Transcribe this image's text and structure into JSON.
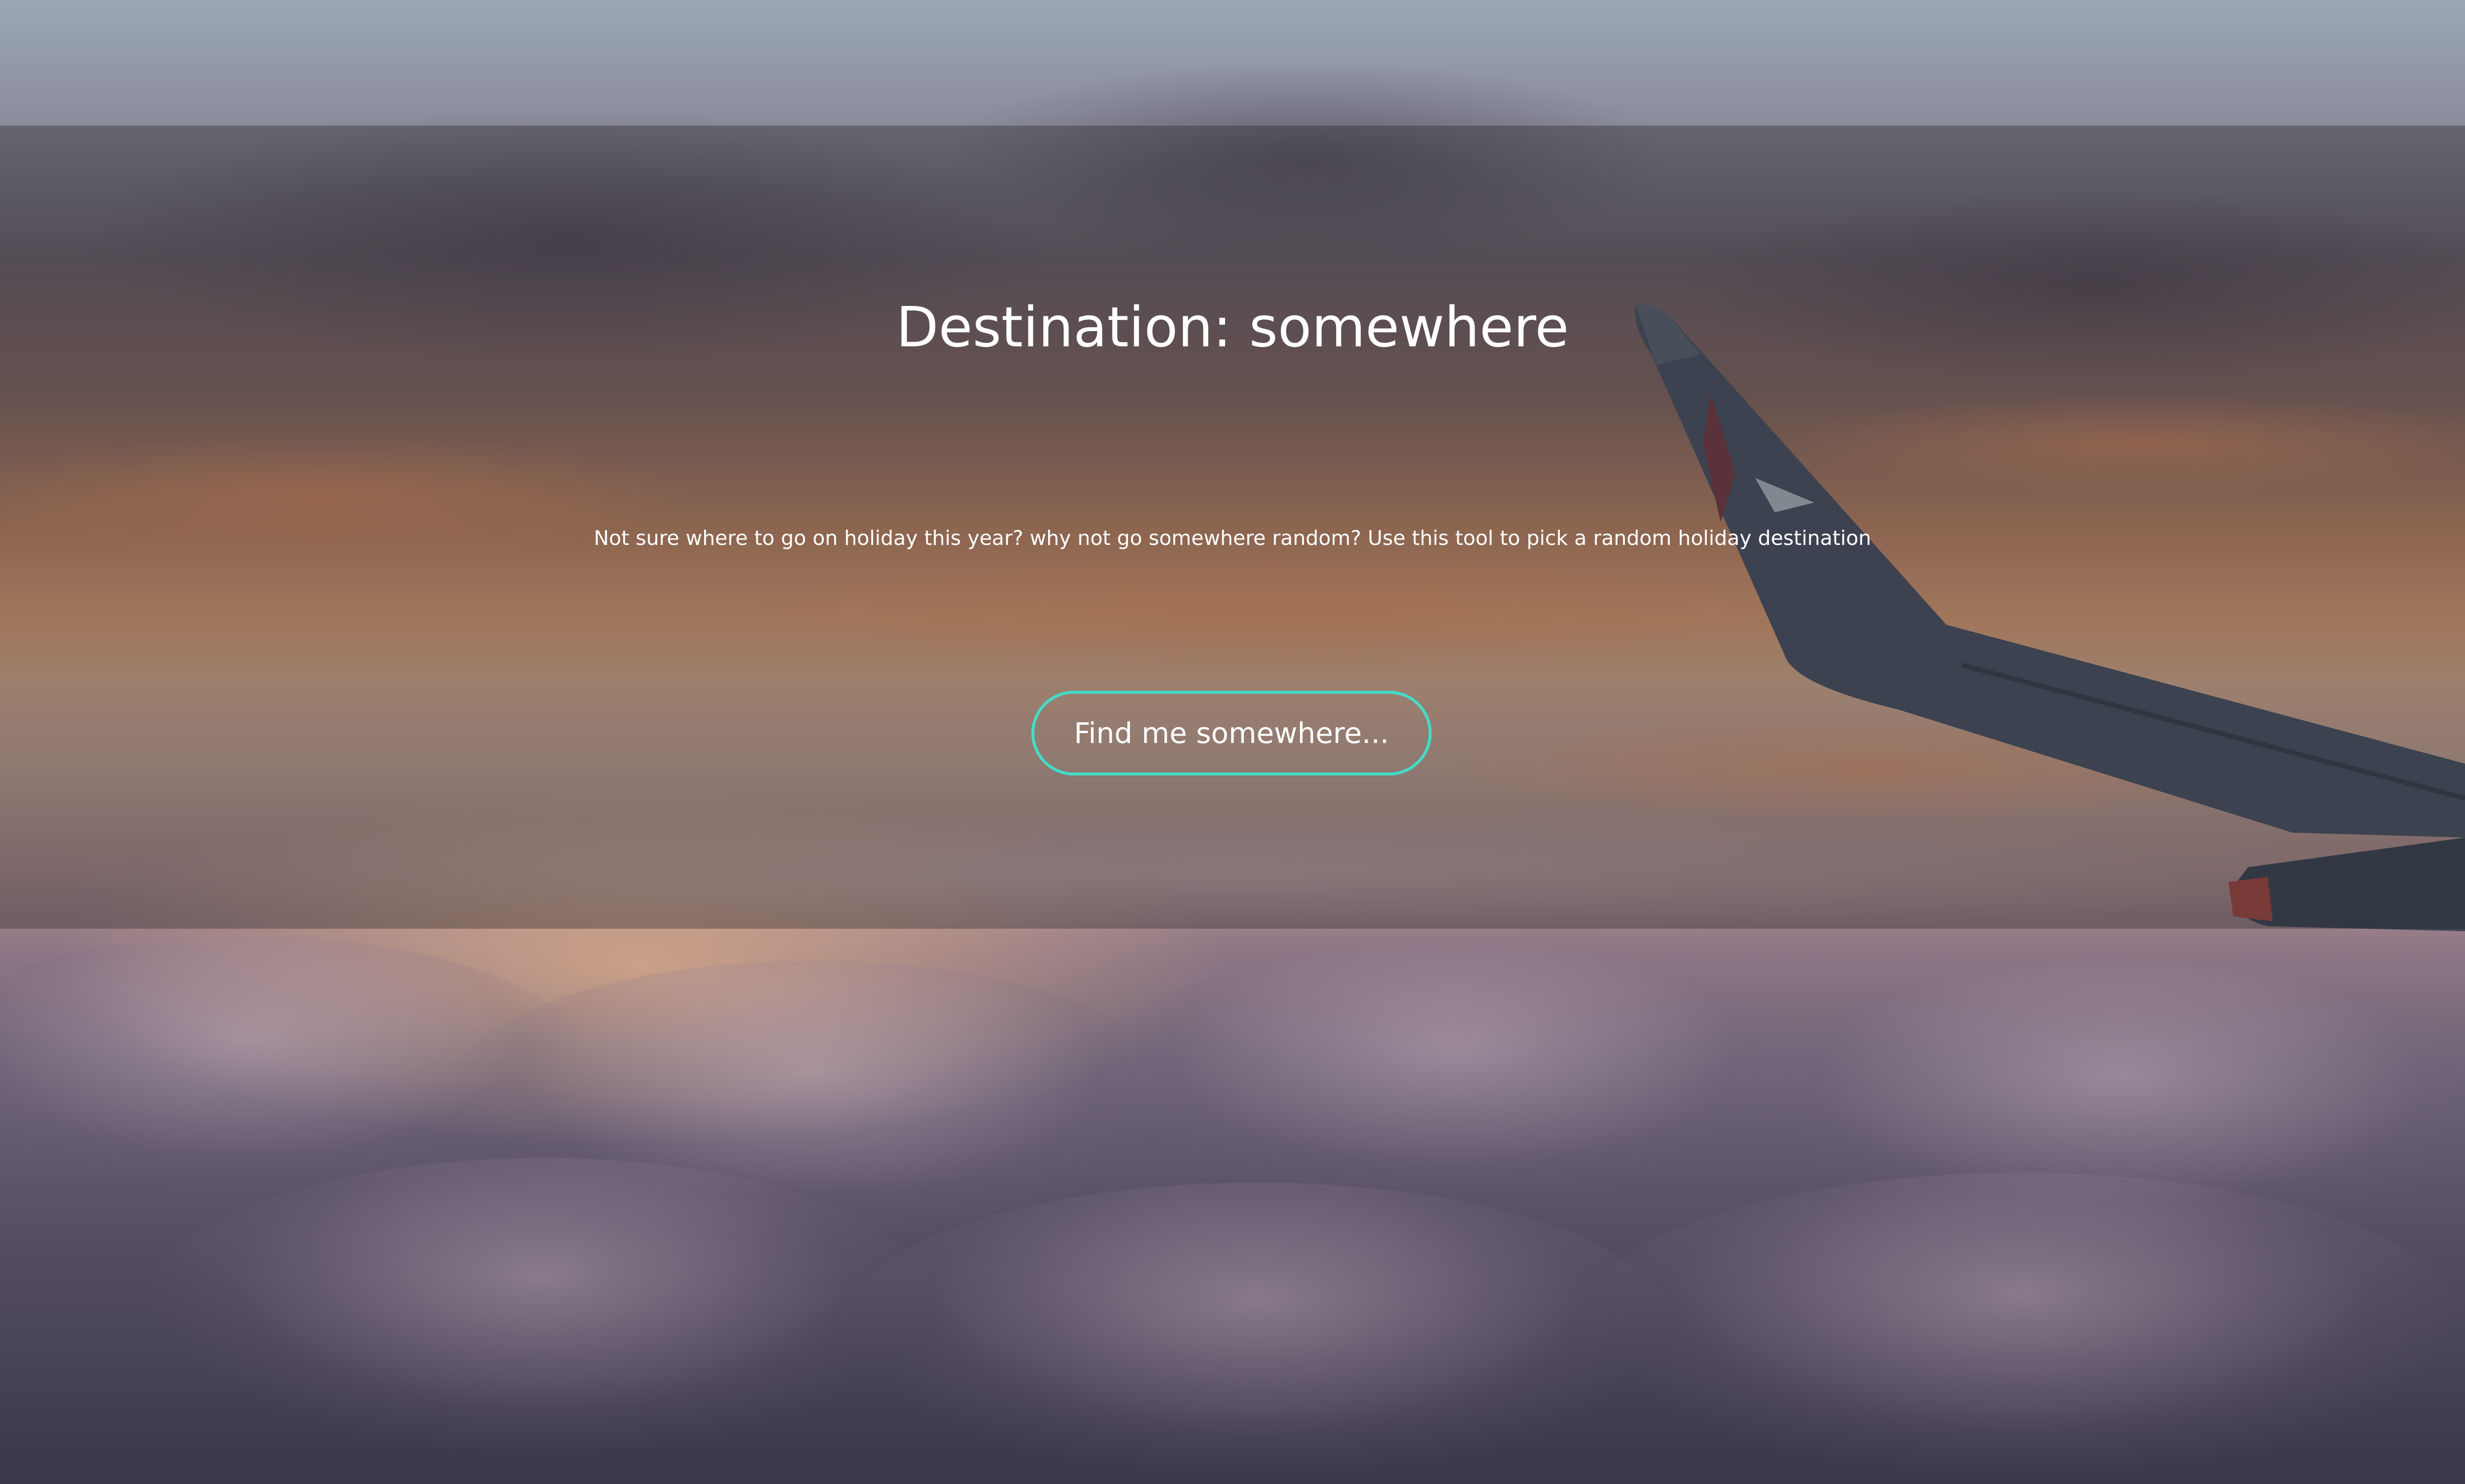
{
  "hero": {
    "title": "Destination: somewhere",
    "description": "Not sure where to go on holiday this year? why not go somewhere random? Use this tool to pick a random holiday destination",
    "button_label": "Find me somewhere..."
  },
  "colors": {
    "button_border": "#44dcc6",
    "text": "#ffffff",
    "overlay": "rgba(35,35,40,0.36)"
  },
  "background": {
    "image": "sunset sky above clouds with airplane wing"
  }
}
